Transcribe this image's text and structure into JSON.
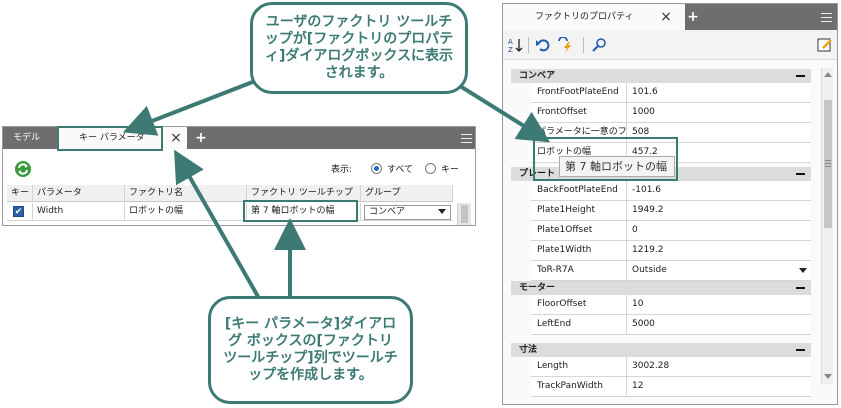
{
  "callouts": {
    "top": "ユーザのファクトリ ツールチップが[ファクトリのプロパティ]ダイアログボックスに表示されます。",
    "bottom": "[キー パラメータ]ダイアログ ボックスの[ファクトリ ツールチップ]列でツールチップを作成します。"
  },
  "left_dialog": {
    "tabs": [
      "モデル",
      "キー パラメータ"
    ],
    "display_label": "表示:",
    "radio_options": [
      {
        "label": "すべて",
        "selected": true
      },
      {
        "label": "キー",
        "selected": false
      }
    ],
    "columns": [
      "キー",
      "パラメータ",
      "ファクトリ名",
      "ファクトリ ツールチップ",
      "グループ"
    ],
    "rows": [
      {
        "key": true,
        "parameter": "Width",
        "factory_name": "ロボットの幅",
        "tooltip": "第 7 軸ロボットの幅",
        "group": "コンベア"
      }
    ]
  },
  "right_panel": {
    "title": "ファクトリのプロパティ",
    "tooltip_popup": "第 7 軸ロボットの幅",
    "categories": [
      {
        "name": "コンベア",
        "rows": [
          {
            "name": "FrontFootPlateEnd",
            "value": "101.6"
          },
          {
            "name": "FrontOffset",
            "value": "1000"
          },
          {
            "name": "パラメータに一意のファ",
            "value": "508"
          },
          {
            "name": "ロボットの幅",
            "value": "457.2"
          }
        ]
      },
      {
        "name": "プレート",
        "rows": [
          {
            "name": "BackFootPlateEnd",
            "value": "-101.6"
          },
          {
            "name": "Plate1Height",
            "value": "1949.2"
          },
          {
            "name": "Plate1Offset",
            "value": "0"
          },
          {
            "name": "Plate1Width",
            "value": "1219.2"
          },
          {
            "name": "ToR-R7A",
            "value": "Outside"
          }
        ]
      },
      {
        "name": "モーター",
        "rows": [
          {
            "name": "FloorOffset",
            "value": "10"
          },
          {
            "name": "LeftEnd",
            "value": "5000"
          }
        ]
      },
      {
        "name": "寸法",
        "rows": [
          {
            "name": "Length",
            "value": "3002.28"
          },
          {
            "name": "TrackPanWidth",
            "value": "12"
          }
        ]
      }
    ]
  },
  "colors": {
    "accent": "#3d7a74",
    "tab_bar": "#6e6e6e",
    "category": "#dcdcdc",
    "checkbox": "#2f5fa8"
  }
}
